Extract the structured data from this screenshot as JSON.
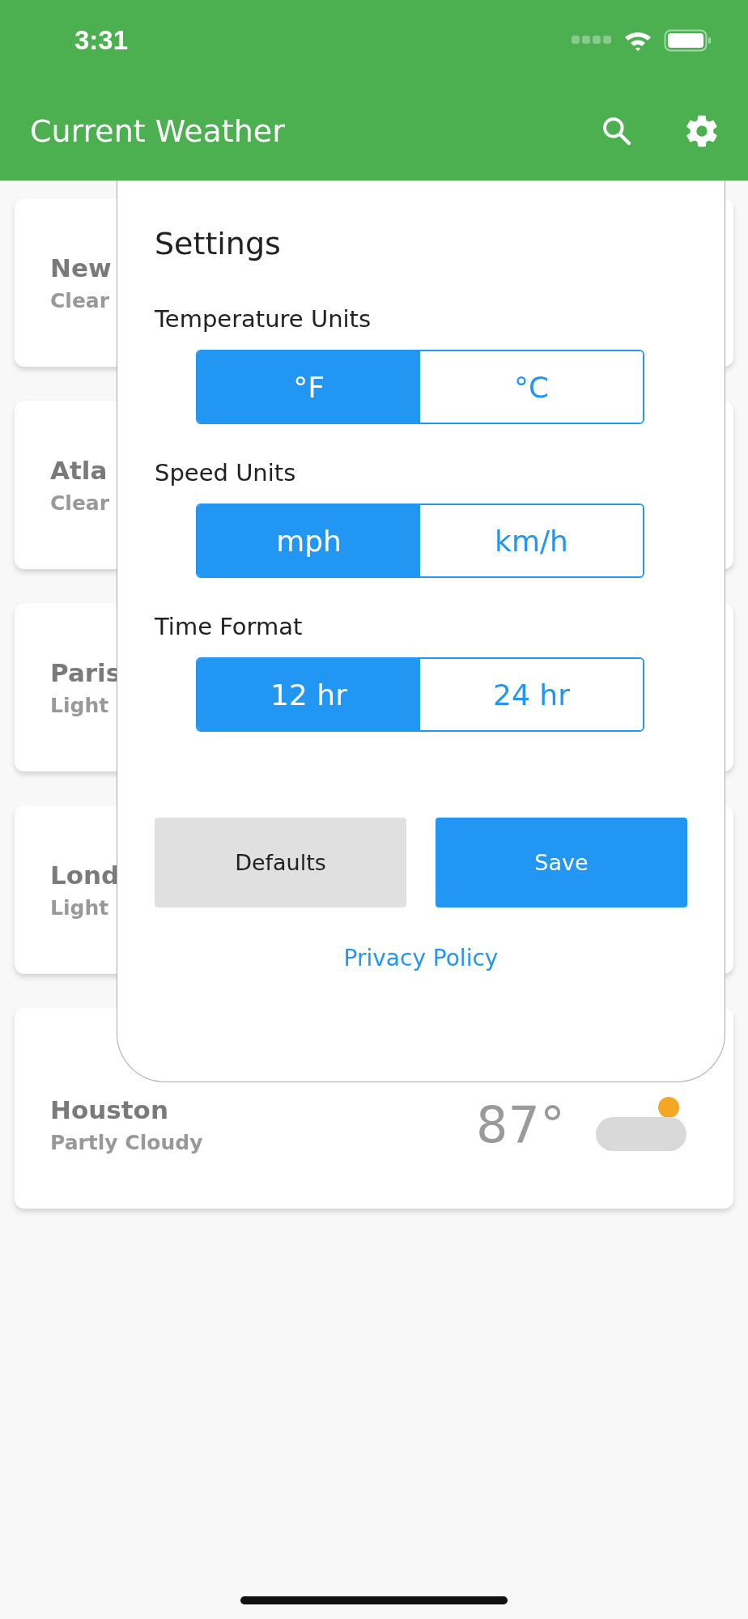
{
  "status_bar": {
    "time": "3:31"
  },
  "app_bar": {
    "title": "Current Weather"
  },
  "cities": [
    {
      "name": "New",
      "condition": "Clear"
    },
    {
      "name": "Atla",
      "condition": "Clear"
    },
    {
      "name": "Paris",
      "condition": "Light"
    },
    {
      "name": "Lond",
      "condition": "Light"
    },
    {
      "name": "Houston",
      "condition": "Partly Cloudy",
      "temperature": "87°",
      "kind": "partly-cloudy"
    }
  ],
  "settings": {
    "title": "Settings",
    "groups": [
      {
        "label": "Temperature Units",
        "options": [
          {
            "label": "°F",
            "selected": true
          },
          {
            "label": "°C",
            "selected": false
          }
        ]
      },
      {
        "label": "Speed Units",
        "options": [
          {
            "label": "mph",
            "selected": true
          },
          {
            "label": "km/h",
            "selected": false
          }
        ]
      },
      {
        "label": "Time Format",
        "options": [
          {
            "label": "12 hr",
            "selected": true
          },
          {
            "label": "24 hr",
            "selected": false
          }
        ]
      }
    ],
    "buttons": [
      {
        "label": "Defaults",
        "kind": "secondary"
      },
      {
        "label": "Save",
        "kind": "primary"
      }
    ],
    "link": "Privacy Policy"
  }
}
